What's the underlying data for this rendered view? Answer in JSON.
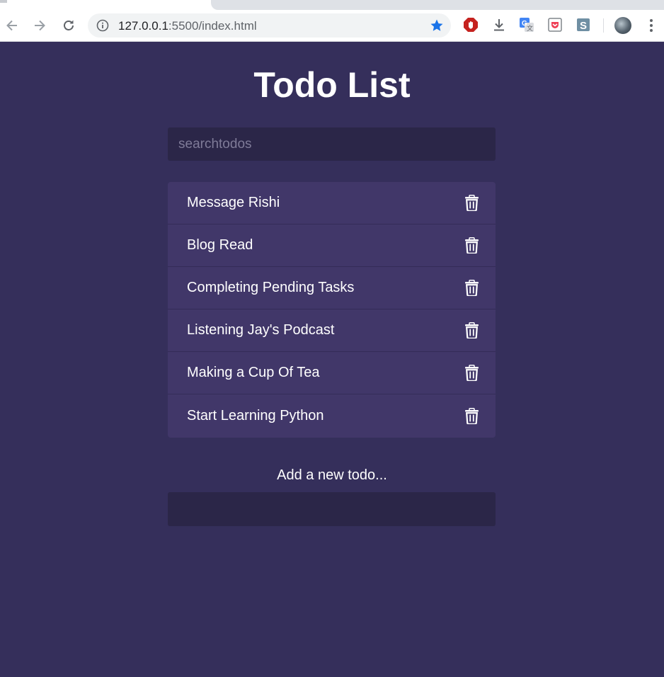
{
  "browser": {
    "url_host": "127.0.0.1",
    "url_path": ":5500/index.html",
    "icons": [
      "back-arrow-icon",
      "forward-arrow-icon",
      "reload-icon",
      "info-icon",
      "star-icon",
      "adblock-icon",
      "download-icon",
      "translate-icon",
      "pocket-icon",
      "s-extension-icon",
      "avatar",
      "kebab-menu-icon"
    ],
    "colors": {
      "star": "#1a73e8",
      "adblock": "#c5221f"
    }
  },
  "app": {
    "title": "Todo List",
    "search_placeholder": "searchtodos",
    "add_label": "Add a new todo...",
    "todos": [
      {
        "text": "Message Rishi"
      },
      {
        "text": "Blog Read"
      },
      {
        "text": "Completing Pending Tasks"
      },
      {
        "text": "Listening Jay's Podcast"
      },
      {
        "text": "Making a Cup Of Tea"
      },
      {
        "text": "Start Learning Python"
      }
    ],
    "colors": {
      "background": "#352f5b",
      "list": "#413769",
      "input": "#2b2648",
      "text": "#ffffff"
    }
  }
}
